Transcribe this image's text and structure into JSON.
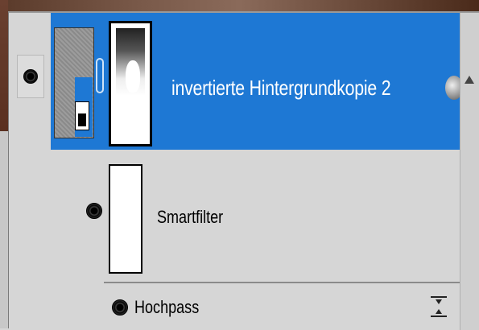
{
  "layers_panel": {
    "layer": {
      "name": "invertierte Hintergrundkopie 2",
      "selected": true,
      "visible": true
    },
    "smart_filters": {
      "label": "Smartfilter",
      "visible": true
    },
    "filters": [
      {
        "label": "Hochpass",
        "visible": true
      }
    ]
  },
  "colors": {
    "selection": "#1e78d4",
    "panel_bg": "#d6d6d6",
    "text_selected": "#ffffff",
    "text": "#000000"
  },
  "icons": {
    "visibility": "eye-icon",
    "link": "chain-link-icon",
    "smart_object": "smart-object-badge-icon",
    "fx": "layer-style-icon",
    "scroll_up": "scroll-up-arrow-icon",
    "blend_options": "blending-options-icon"
  }
}
